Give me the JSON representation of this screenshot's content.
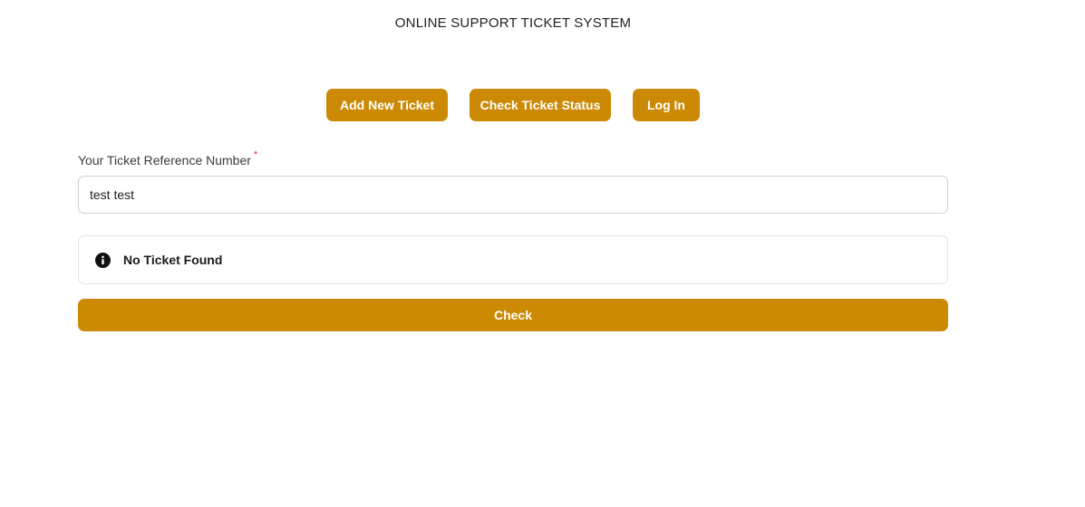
{
  "header": {
    "title": "ONLINE SUPPORT TICKET SYSTEM"
  },
  "nav": {
    "add_ticket_label": "Add New Ticket",
    "check_status_label": "Check Ticket Status",
    "login_label": "Log In"
  },
  "form": {
    "reference_label": "Your Ticket Reference Number",
    "required_mark": "*",
    "reference_value": "test test",
    "alert_icon": "info-circle-icon",
    "alert_message": "No Ticket Found",
    "check_label": "Check"
  },
  "colors": {
    "accent": "#CC8A04",
    "required": "#d9342b",
    "alert_icon": "#111111"
  }
}
